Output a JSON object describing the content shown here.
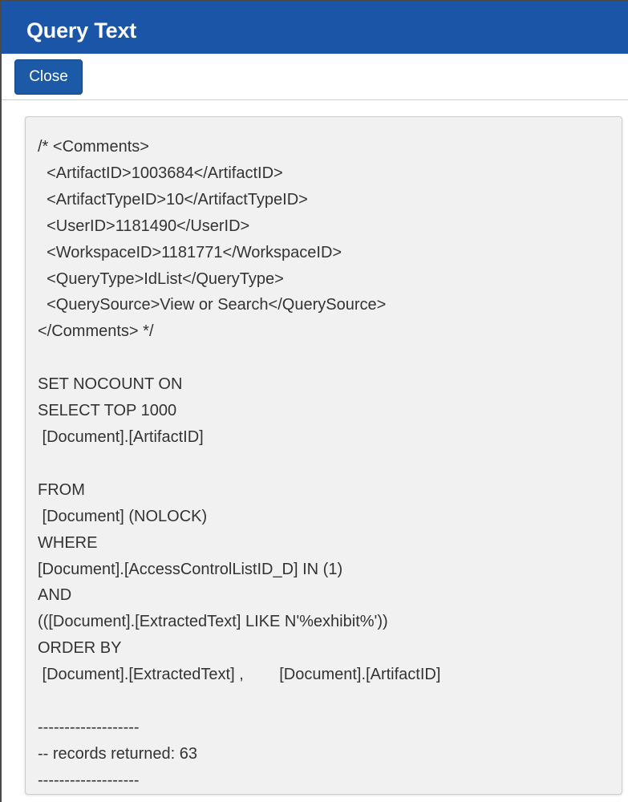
{
  "dialog": {
    "title": "Query Text",
    "close_label": "Close"
  },
  "query": {
    "text": "/* <Comments>\n  <ArtifactID>1003684</ArtifactID>\n  <ArtifactTypeID>10</ArtifactTypeID>\n  <UserID>1181490</UserID>\n  <WorkspaceID>1181771</WorkspaceID>\n  <QueryType>IdList</QueryType>\n  <QuerySource>View or Search</QuerySource>\n</Comments> */\n\nSET NOCOUNT ON\nSELECT TOP 1000\n [Document].[ArtifactID]\n\nFROM\n [Document] (NOLOCK)\nWHERE\n[Document].[AccessControlListID_D] IN (1)\nAND\n(([Document].[ExtractedText] LIKE N'%exhibit%'))\nORDER BY\n [Document].[ExtractedText] ,        [Document].[ArtifactID]\n\n-------------------\n-- records returned: 63\n-------------------"
  },
  "colors": {
    "header_background": "#1b55a8",
    "button_background": "#1c5aa8",
    "panel_background": "#f1f1f1",
    "text": "#333333"
  }
}
